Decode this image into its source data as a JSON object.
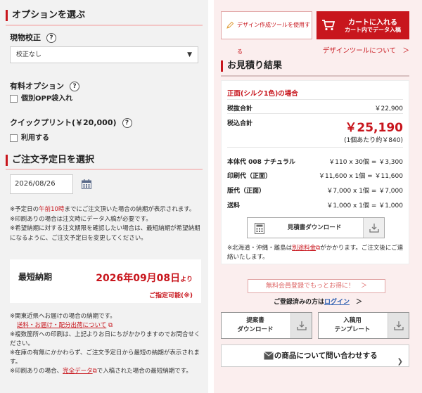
{
  "options": {
    "title": "オプションを選ぶ",
    "proof_label": "現物校正",
    "proof_select": "校正なし",
    "paid_label": "有料オプション",
    "paid_item": "個別OPP袋入れ",
    "quick_label": "クイックプリント(￥20,000)",
    "quick_item": "利用する",
    "help": "?"
  },
  "order_date": {
    "title": "ご注文予定日を選択",
    "value": "2026/08/26",
    "note1_a": "※予定日の",
    "note1_b": "午前10時",
    "note1_c": "までにご注文頂いた場合の納期が表示されます。",
    "note2": "※印刷ありの場合は注文時にデータ入稿が必要です。",
    "note3": "※希望納期に対する注文期限を確認したい場合は、最短納期が希望納期になるように、ご注文予定日を変更してください。"
  },
  "min_delivery": {
    "label": "最短納期",
    "date": "2026年09月08日",
    "suffix": "より",
    "available": "ご指定可能(※)"
  },
  "notes2": {
    "n1": "※関東近県へお届けの場合の納期です。",
    "link1": "送料・お届け・配分出荷について",
    "n2": "※複数箇所への印刷は、上記よりお日にちがかかりますのでお問合せください。",
    "n3": "※在庫の有無にかかわらず、ご注文予定日から最短の納期が表示されます。",
    "n4_a": "※印刷ありの場合、",
    "n4_link": "完全データ",
    "n4_b": "で入稿された場合の最短納期です。"
  },
  "actions": {
    "design_tool": "デザイン作成ツールを使用する",
    "cart_l1": "カートに入れる",
    "cart_l2": "カート内でデータ入稿",
    "design_about": "デザインツールについて　＞"
  },
  "estimate": {
    "title": "お見積り結果",
    "case": "正面(シルク1色)の場合",
    "subtotal_k": "税抜合計",
    "subtotal_v": "￥22,900",
    "total_k": "税込合計",
    "total_v": "￥25,190",
    "per_unit": "(1個あたり約￥840)",
    "rows": [
      {
        "k": "本体代 008 ナチュラル",
        "v": "￥110 x 30個 = ￥3,300"
      },
      {
        "k": "印刷代（正面）",
        "v": "￥11,600 x 1個 = ￥11,600"
      },
      {
        "k": "版代（正面）",
        "v": "￥7,000 x 1個 = ￥7,000"
      },
      {
        "k": "送料",
        "v": "￥1,000 x 1個 = ￥1,000"
      }
    ],
    "pdf": "見積書ダウンロード",
    "note_a": "※北海道・沖縄・離島は",
    "note_link": "別途料金",
    "note_b": "がかかります。ご注文後にご連絡いたします。"
  },
  "bottom": {
    "member": "無料会員登録でもっとお得に！　＞",
    "login_a": "ご登録済みの方は",
    "login_link": "ログイン",
    "login_b": "　＞",
    "proposal_l1": "提案書",
    "proposal_l2": "ダウンロード",
    "template_l1": "入稿用",
    "template_l2": "テンプレート",
    "contact": "この商品について問い合わせする"
  }
}
